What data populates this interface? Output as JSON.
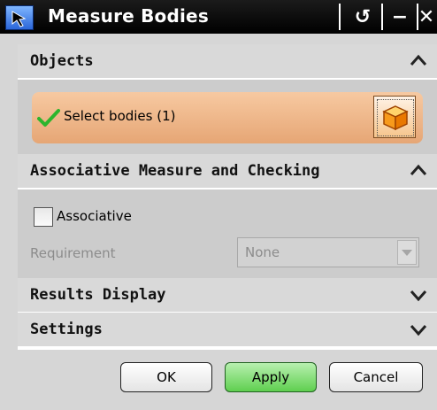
{
  "window": {
    "title": "Measure Bodies",
    "controls": {
      "reset": "↺",
      "minimize": "−",
      "close": "✕"
    }
  },
  "sections": {
    "objects": {
      "title": "Objects",
      "state": "expanded"
    },
    "associative": {
      "title": "Associative Measure and Checking",
      "state": "expanded"
    },
    "results": {
      "title": "Results Display",
      "state": "collapsed"
    },
    "settings": {
      "title": "Settings",
      "state": "collapsed"
    }
  },
  "objects": {
    "select_label": "Select bodies (1)"
  },
  "associative": {
    "checkbox_label": "Associative",
    "checked": false,
    "requirement_label": "Requirement",
    "requirement_value": "None"
  },
  "buttons": {
    "ok": "OK",
    "apply": "Apply",
    "cancel": "Cancel"
  },
  "colors": {
    "title_bar": "#000000",
    "select_highlight": "#f0b68a",
    "apply": "#5fcf4f"
  }
}
